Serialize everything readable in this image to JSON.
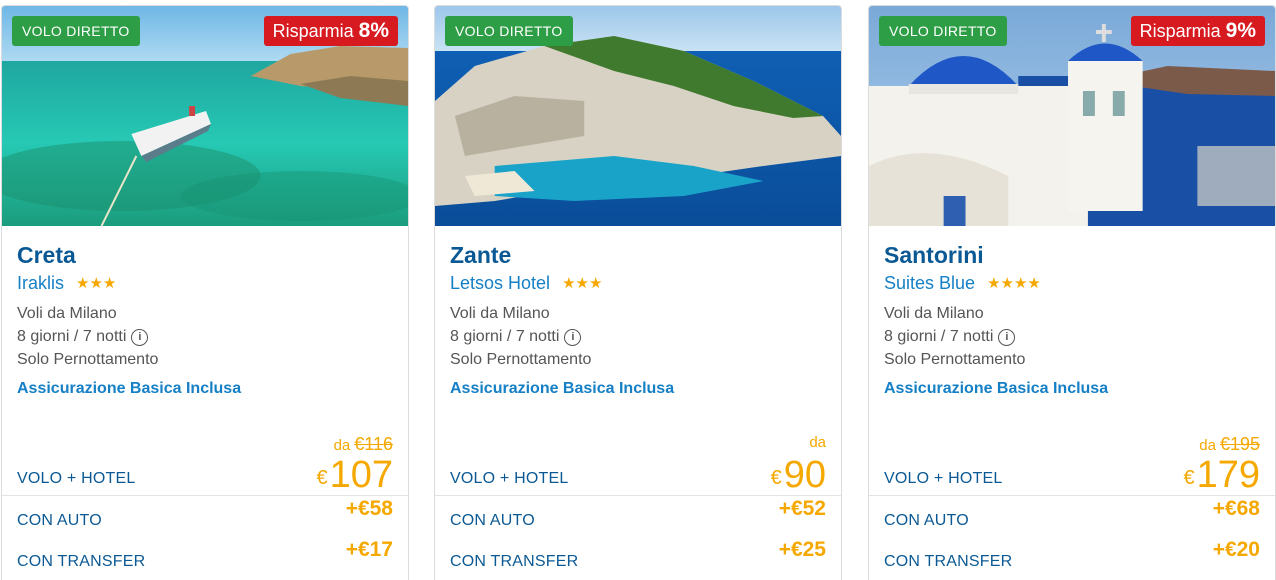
{
  "cards": [
    {
      "badge_direct": "VOLO DIRETTO",
      "save_label": "Risparmia",
      "save_percent": "8%",
      "destination": "Creta",
      "hotel": "Iraklis",
      "stars": "★★★",
      "rating_stars": 3,
      "departure": "Voli da Milano",
      "duration": "8 giorni / 7 notti",
      "info_icon": "i",
      "board": "Solo Pernottamento",
      "insurance": "Assicurazione Basica Inclusa",
      "price_from_label": "da",
      "price_old": "€116",
      "currency": "€",
      "price": "107",
      "volo_hotel": "VOLO + HOTEL",
      "con_auto": "CON AUTO",
      "con_auto_price": "+€58",
      "con_transfer": "CON TRANSFER",
      "con_transfer_price": "+€17"
    },
    {
      "badge_direct": "VOLO DIRETTO",
      "destination": "Zante",
      "hotel": "Letsos Hotel",
      "stars": "★★★",
      "rating_stars": 3,
      "departure": "Voli da Milano",
      "duration": "8 giorni / 7 notti",
      "info_icon": "i",
      "board": "Solo Pernottamento",
      "insurance": "Assicurazione Basica Inclusa",
      "price_from_label": "da",
      "currency": "€",
      "price": "90",
      "volo_hotel": "VOLO + HOTEL",
      "con_auto": "CON AUTO",
      "con_auto_price": "+€52",
      "con_transfer": "CON TRANSFER",
      "con_transfer_price": "+€25"
    },
    {
      "badge_direct": "VOLO DIRETTO",
      "save_label": "Risparmia",
      "save_percent": "9%",
      "destination": "Santorini",
      "hotel": "Suites Blue",
      "stars": "★★★★",
      "rating_stars": 4,
      "departure": "Voli da Milano",
      "duration": "8 giorni / 7 notti",
      "info_icon": "i",
      "board": "Solo Pernottamento",
      "insurance": "Assicurazione Basica Inclusa",
      "price_from_label": "da",
      "price_old": "€195",
      "currency": "€",
      "price": "179",
      "volo_hotel": "VOLO + HOTEL",
      "con_auto": "CON AUTO",
      "con_auto_price": "+€68",
      "con_transfer": "CON TRANSFER",
      "con_transfer_price": "+€20"
    }
  ],
  "colors": {
    "brand_blue": "#0b5994",
    "link_blue": "#1680c6",
    "price_orange": "#f5a800",
    "direct_green": "#2e9e46",
    "save_red": "#d71920"
  }
}
